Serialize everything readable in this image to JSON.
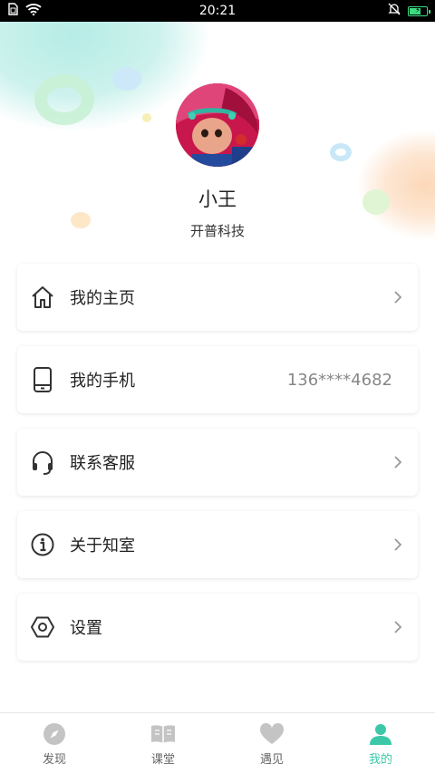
{
  "status_bar": {
    "time": "20:21"
  },
  "profile": {
    "name": "小王",
    "company": "开普科技"
  },
  "menu": [
    {
      "icon": "home-icon",
      "label": "我的主页",
      "value": "",
      "chevron": true
    },
    {
      "icon": "phone-icon",
      "label": "我的手机",
      "value": "136****4682",
      "chevron": false
    },
    {
      "icon": "headset-icon",
      "label": "联系客服",
      "value": "",
      "chevron": true
    },
    {
      "icon": "info-icon",
      "label": "关于知室",
      "value": "",
      "chevron": true
    },
    {
      "icon": "settings-icon",
      "label": "设置",
      "value": "",
      "chevron": true
    }
  ],
  "bottom_nav": [
    {
      "icon": "compass-icon",
      "label": "发现",
      "active": false
    },
    {
      "icon": "book-icon",
      "label": "课堂",
      "active": false
    },
    {
      "icon": "heart-icon",
      "label": "遇见",
      "active": false
    },
    {
      "icon": "person-icon",
      "label": "我的",
      "active": true
    }
  ],
  "colors": {
    "accent": "#3cc8a8",
    "inactive_icon": "#c4c4c4",
    "text": "#222222",
    "muted": "#888888"
  }
}
